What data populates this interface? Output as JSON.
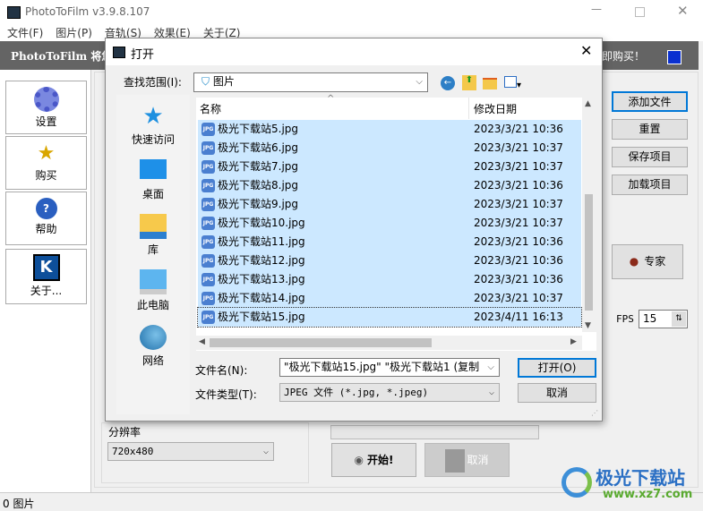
{
  "app": {
    "title": "PhotoToFilm v3.9.8.107",
    "menu": [
      "文件(F)",
      "图片(P)",
      "音轨(S)",
      "效果(E)",
      "关于(Z)"
    ],
    "banner_left": "PhotoToFilm 将您",
    "banner_right": "即购买！",
    "sidebar": [
      "设置",
      "购买",
      "帮助",
      "关于..."
    ],
    "right_buttons": [
      "添加文件",
      "重置",
      "保存项目",
      "加载项目"
    ],
    "expert": "专家",
    "fps_label": "FPS",
    "fps_value": "15",
    "resolution_label": "分辨率",
    "resolution_value": "720x480",
    "start": "开始!",
    "cancel": "取消",
    "status": "0 图片"
  },
  "dialog": {
    "title": "打开",
    "look_in_label": "查找范围(I):",
    "look_in_value": "图片",
    "places": [
      "快速访问",
      "桌面",
      "库",
      "此电脑",
      "网络"
    ],
    "columns": [
      "名称",
      "修改日期"
    ],
    "files": [
      {
        "name": "极光下载站5.jpg",
        "date": "2023/3/21 10:36"
      },
      {
        "name": "极光下载站6.jpg",
        "date": "2023/3/21 10:37"
      },
      {
        "name": "极光下载站7.jpg",
        "date": "2023/3/21 10:37"
      },
      {
        "name": "极光下载站8.jpg",
        "date": "2023/3/21 10:36"
      },
      {
        "name": "极光下载站9.jpg",
        "date": "2023/3/21 10:37"
      },
      {
        "name": "极光下载站10.jpg",
        "date": "2023/3/21 10:37"
      },
      {
        "name": "极光下载站11.jpg",
        "date": "2023/3/21 10:36"
      },
      {
        "name": "极光下载站12.jpg",
        "date": "2023/3/21 10:36"
      },
      {
        "name": "极光下载站13.jpg",
        "date": "2023/3/21 10:36"
      },
      {
        "name": "极光下载站14.jpg",
        "date": "2023/3/21 10:37"
      },
      {
        "name": "极光下载站15.jpg",
        "date": "2023/4/11 16:13"
      }
    ],
    "filename_label": "文件名(N):",
    "filename_value": "\"极光下载站15.jpg\" \"极光下载站1 (复制",
    "filetype_label": "文件类型(T):",
    "filetype_value": "JPEG 文件 (*.jpg, *.jpeg)",
    "open": "打开(O)",
    "cancel": "取消"
  },
  "watermark": {
    "name": "极光下载站",
    "url": "www.xz7.com"
  }
}
